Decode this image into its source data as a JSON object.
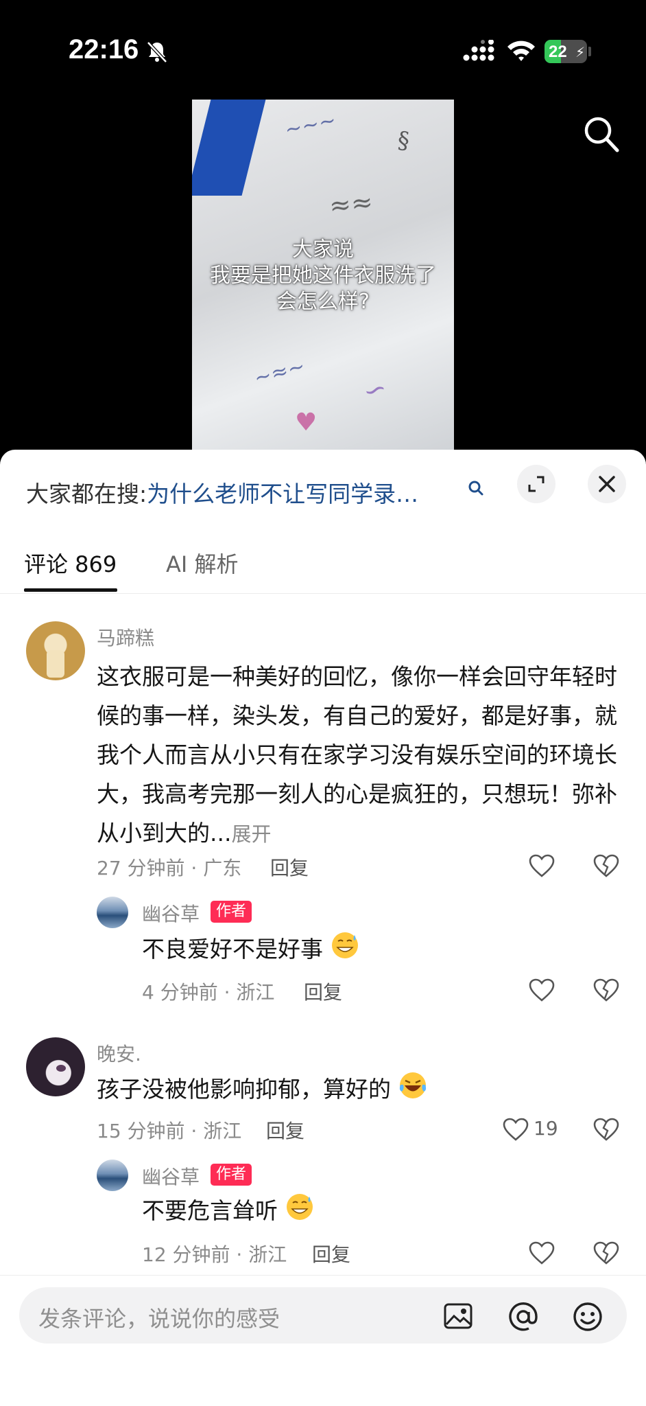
{
  "status_bar": {
    "time": "22:16",
    "battery": "22"
  },
  "video": {
    "caption_lines": [
      "大家说",
      "我要是把她这件衣服洗了",
      "会怎么样?"
    ]
  },
  "hot_search": {
    "prefix": "大家都在搜:",
    "query": "为什么老师不让写同学录…"
  },
  "tabs": {
    "comments": "评论 869",
    "ai": "AI 解析"
  },
  "comments": [
    {
      "user": "马蹄糕",
      "text": "这衣服可是一种美好的回忆，像你一样会回守年轻时候的事一样，染头发，有自己的爱好，都是好事，就我个人而言从小只有在家学习没有娱乐空间的环境长大，我高考完那一刻人的心是疯狂的，只想玩！弥补从小到大的...",
      "expand": "展开",
      "meta": "27 分钟前 · 广东",
      "reply": "回复",
      "likes": "",
      "reply_item": {
        "user": "幽谷草",
        "badge": "作者",
        "text": "不良爱好不是好事",
        "meta": "4 分钟前 · 浙江",
        "reply": "回复",
        "likes": ""
      }
    },
    {
      "user": "晚安.",
      "text": "孩子没被他影响抑郁，算好的",
      "meta": "15 分钟前 · 浙江",
      "reply": "回复",
      "likes": "19",
      "reply_item": {
        "user": "幽谷草",
        "badge": "作者",
        "text": "不要危言耸听",
        "meta": "12 分钟前 · 浙江",
        "reply": "回复",
        "likes": ""
      }
    }
  ],
  "input": {
    "placeholder": "发条评论，说说你的感受"
  },
  "icons": {
    "status": [
      "bell-off-icon",
      "signal-icon",
      "wifi-icon",
      "battery-icon"
    ],
    "actions": [
      "search-icon",
      "expand-icon",
      "close-icon",
      "heart-icon",
      "dislike-heart-icon",
      "image-icon",
      "at-icon",
      "emoji-icon"
    ]
  },
  "colors": {
    "accent": "#fe2c55",
    "link": "#1f4e8c",
    "muted": "#8a8a8a"
  }
}
